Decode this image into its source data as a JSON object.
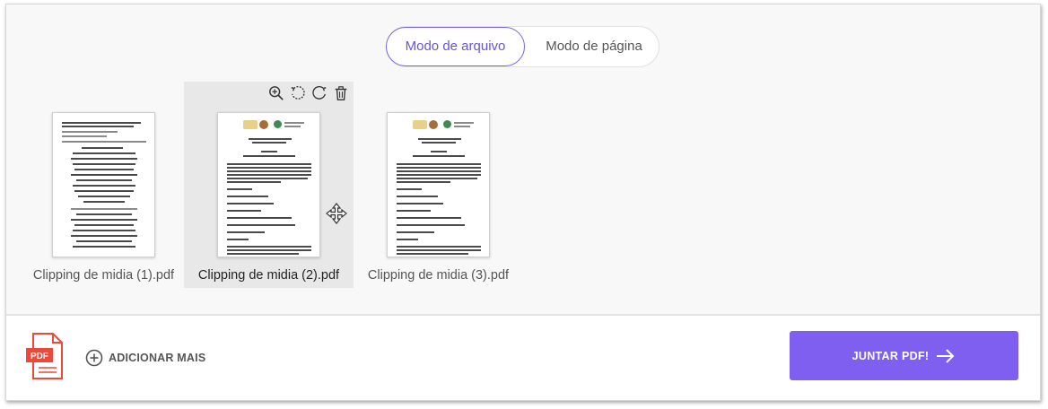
{
  "modes": {
    "file_mode": "Modo de arquivo",
    "page_mode": "Modo de página",
    "active": "file_mode"
  },
  "files": [
    {
      "name": "Clipping de midia (1).pdf",
      "selected": false
    },
    {
      "name": "Clipping de midia (2).pdf",
      "selected": true
    },
    {
      "name": "Clipping de midia (3).pdf",
      "selected": false
    }
  ],
  "card_tools": [
    "zoom-in-icon",
    "rotate-left-icon",
    "rotate-right-icon",
    "trash-icon"
  ],
  "footer": {
    "pdf_icon_label": "PDF",
    "add_more_label": "ADICIONAR MAIS",
    "merge_button_label": "JUNTAR PDF!"
  },
  "colors": {
    "accent": "#7e5ff0",
    "pdf_icon": "#e94a3c"
  }
}
